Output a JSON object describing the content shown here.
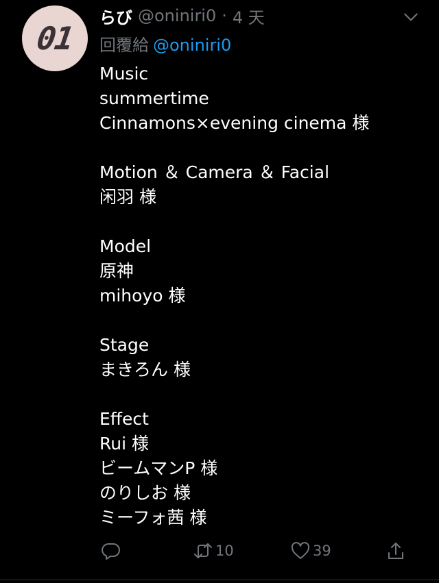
{
  "tweet": {
    "avatar_text": "01",
    "display_name": "らび",
    "handle": "@oniniri0",
    "separator": "·",
    "time": "4 天",
    "reply_prefix": "回覆給",
    "reply_to": "@oniniri0",
    "lines": [
      "Music",
      "summertime",
      "Cinnamons×evening cinema 様",
      "",
      "Motion ＆ Camera ＆ Facial",
      "闲羽 様",
      "",
      "Model",
      "原神",
      "mihoyo 様",
      "",
      "Stage",
      "まきろん 様",
      "",
      "Effect",
      "Rui 様",
      "ビームマンP 様",
      "のりしお 様",
      "ミーフォ茜 様"
    ]
  },
  "actions": {
    "reply_icon": "reply-icon",
    "retweet_icon": "retweet-icon",
    "retweet_count": "10",
    "like_icon": "heart-icon",
    "like_count": "39",
    "share_icon": "share-icon"
  },
  "colors": {
    "background": "#000000",
    "text": "#ffffff",
    "muted": "#71767b",
    "link": "#1d9bf0",
    "divider": "#2f3336"
  }
}
